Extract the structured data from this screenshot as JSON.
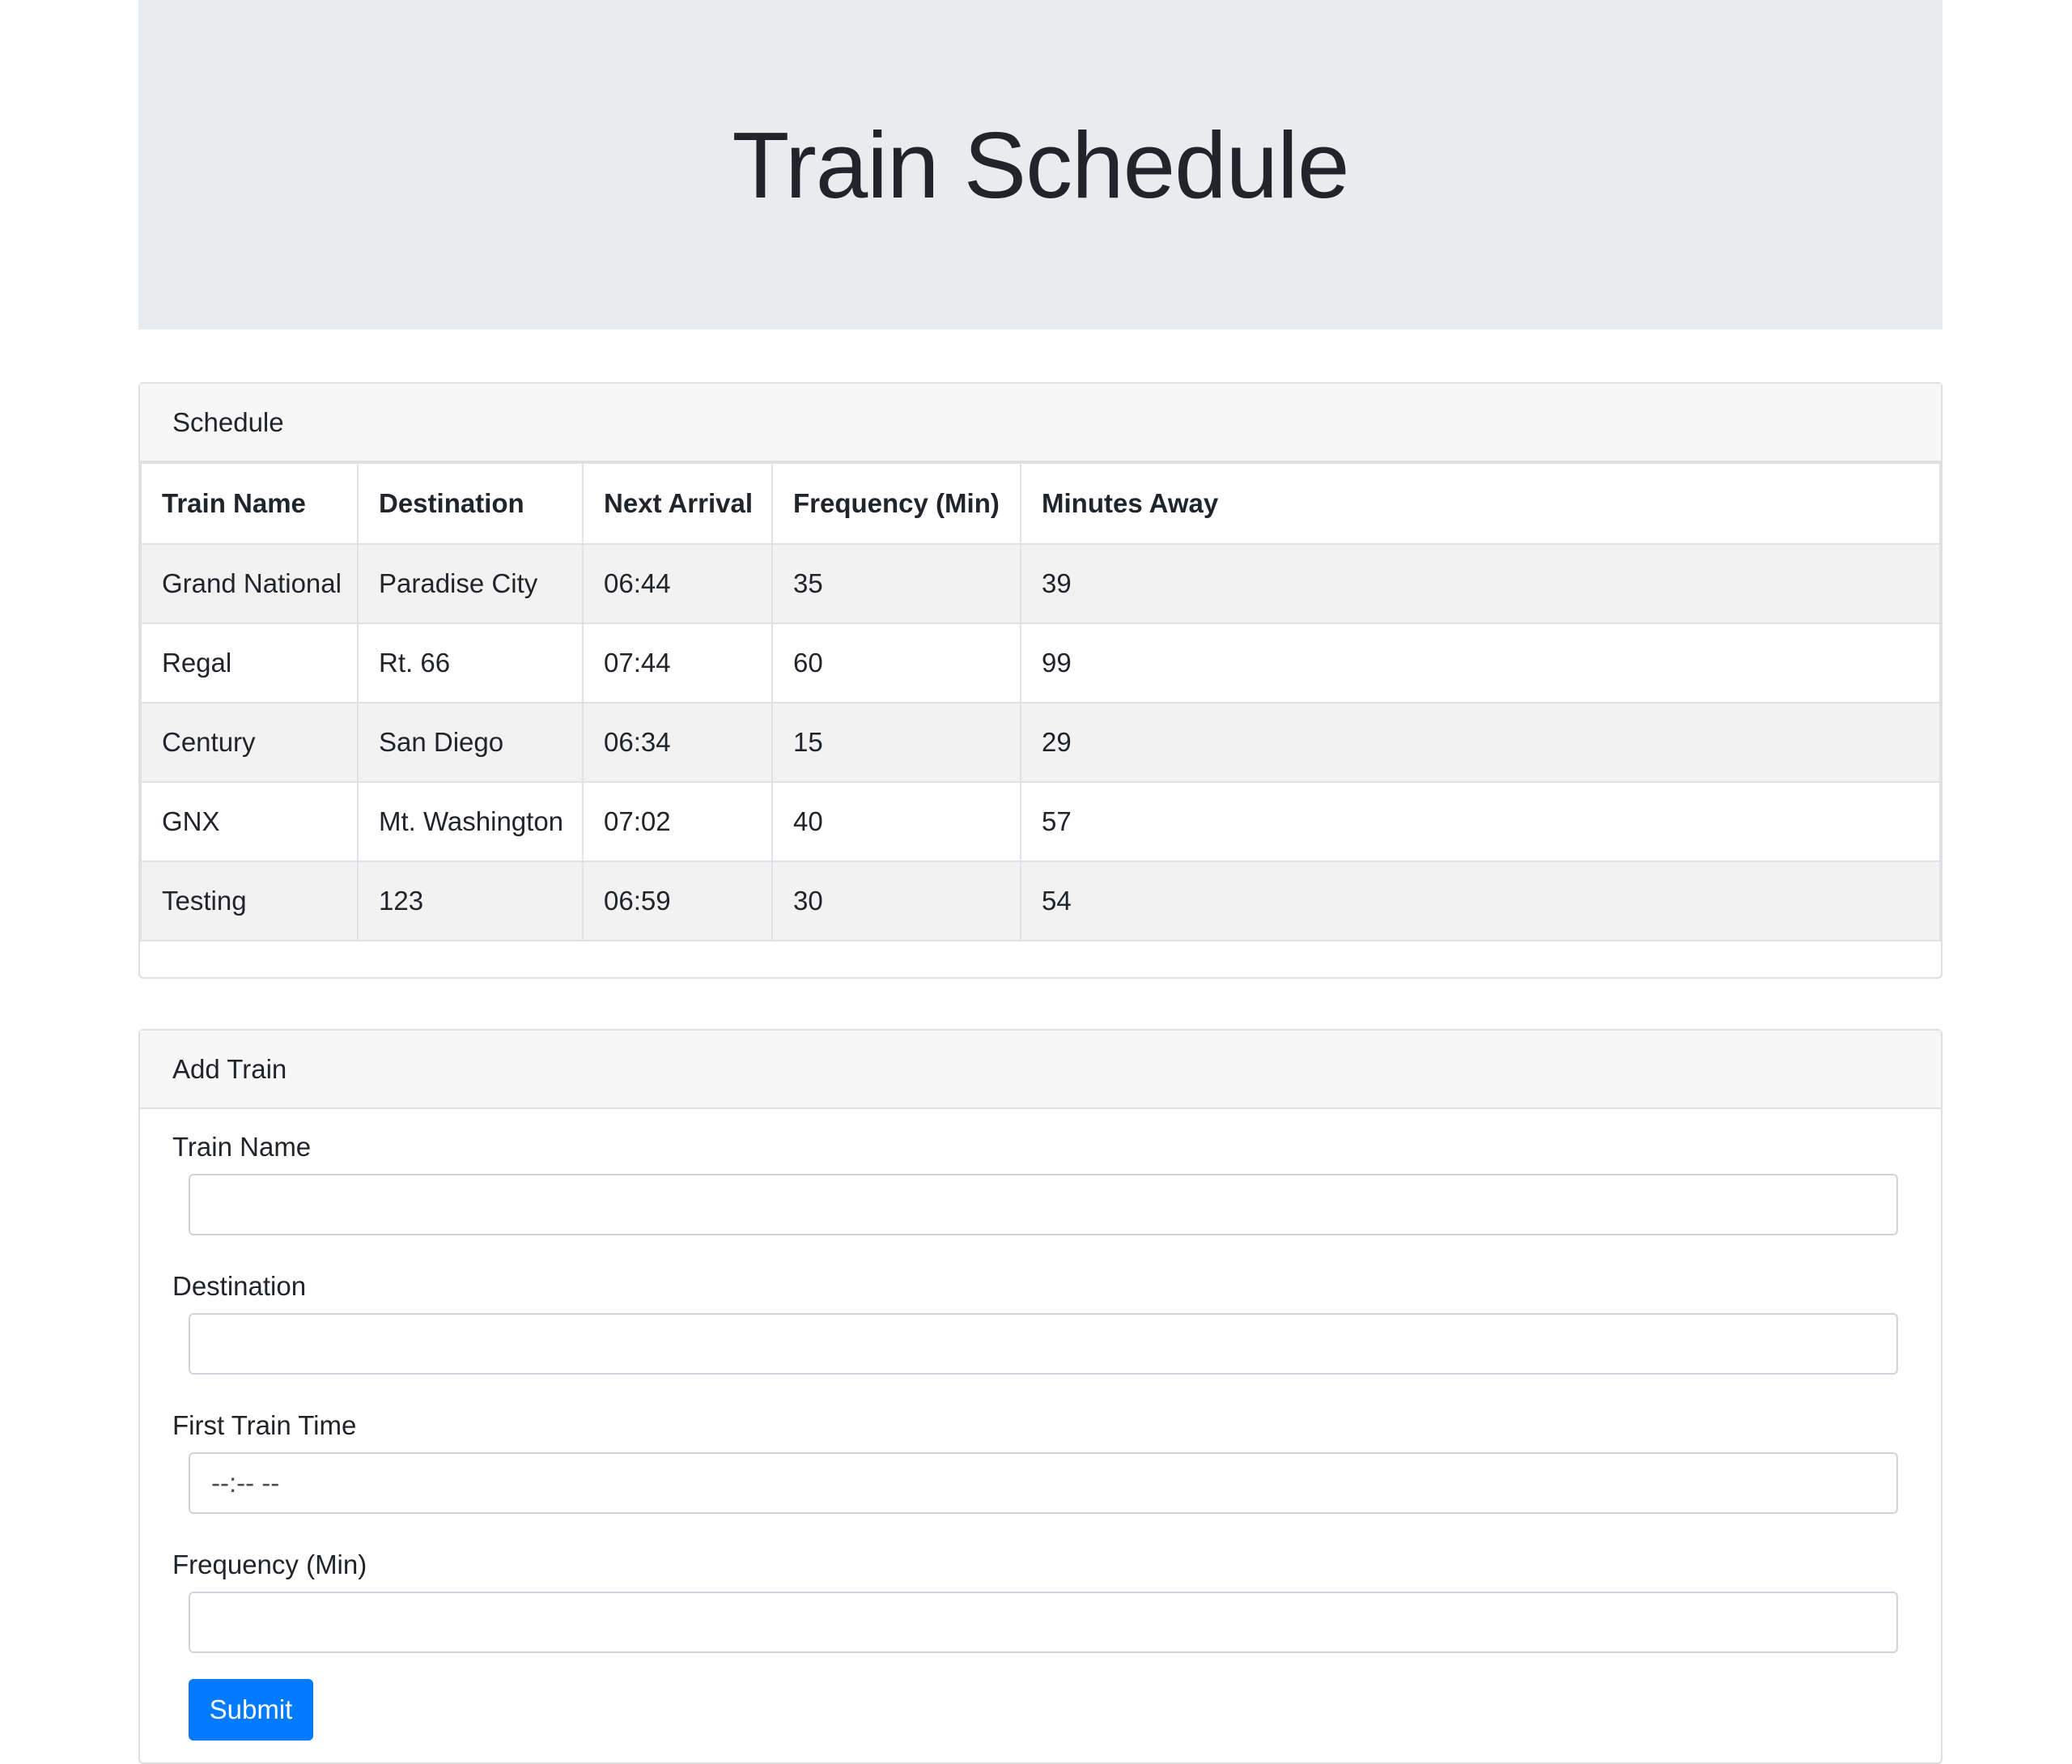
{
  "header": {
    "title": "Train Schedule"
  },
  "schedule": {
    "title": "Schedule",
    "columns": [
      "Train Name",
      "Destination",
      "Next Arrival",
      "Frequency (Min)",
      "Minutes Away"
    ],
    "rows": [
      [
        "Grand National",
        "Paradise City",
        "06:44",
        "35",
        "39"
      ],
      [
        "Regal",
        "Rt. 66",
        "07:44",
        "60",
        "99"
      ],
      [
        "Century",
        "San Diego",
        "06:34",
        "15",
        "29"
      ],
      [
        "GNX",
        "Mt. Washington",
        "07:02",
        "40",
        "57"
      ],
      [
        "Testing",
        "123",
        "06:59",
        "30",
        "54"
      ]
    ]
  },
  "add_train": {
    "title": "Add Train",
    "fields": {
      "train_name": {
        "label": "Train Name",
        "value": ""
      },
      "destination": {
        "label": "Destination",
        "value": ""
      },
      "first_time": {
        "label": "First Train Time",
        "placeholder": "--:-- --"
      },
      "frequency": {
        "label": "Frequency (Min)",
        "value": ""
      }
    },
    "submit_label": "Submit"
  }
}
